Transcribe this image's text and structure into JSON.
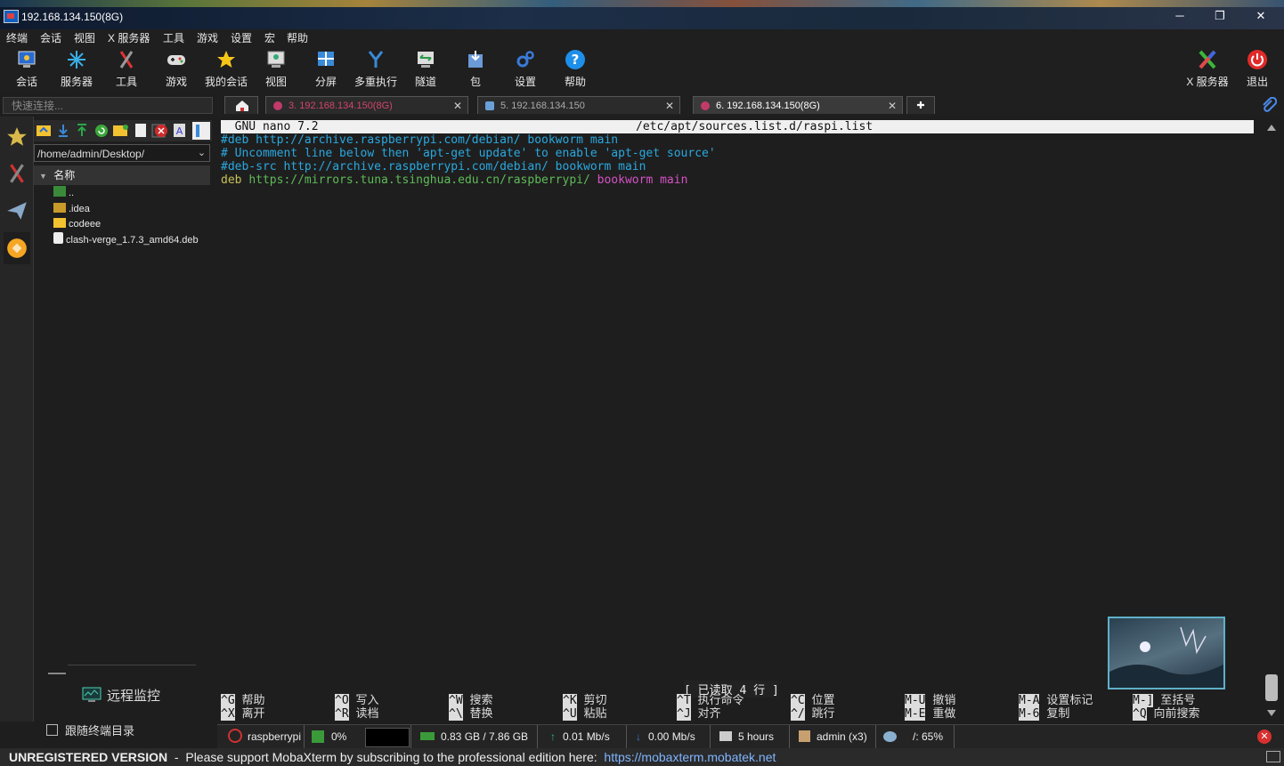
{
  "window": {
    "title": "192.168.134.150(8G)",
    "minimize": "─",
    "maximize": "❐",
    "close": "✕"
  },
  "menu": [
    "终端",
    "会话",
    "视图",
    "X 服务器",
    "工具",
    "游戏",
    "设置",
    "宏",
    "帮助"
  ],
  "toolbar": [
    {
      "label": "会话",
      "icon": "session-icon"
    },
    {
      "label": "服务器",
      "icon": "servers-icon"
    },
    {
      "label": "工具",
      "icon": "tools-icon"
    },
    {
      "label": "游戏",
      "icon": "games-icon"
    },
    {
      "label": "我的会话",
      "icon": "star-icon"
    },
    {
      "label": "视图",
      "icon": "view-icon"
    },
    {
      "label": "分屏",
      "icon": "split-icon"
    },
    {
      "label": "多重执行",
      "icon": "multiexec-icon"
    },
    {
      "label": "隧道",
      "icon": "tunnel-icon"
    },
    {
      "label": "包",
      "icon": "package-icon"
    },
    {
      "label": "设置",
      "icon": "settings-icon"
    },
    {
      "label": "帮助",
      "icon": "help-icon"
    }
  ],
  "toolbar_right": [
    {
      "label": "X 服务器",
      "icon": "xserver-icon"
    },
    {
      "label": "退出",
      "icon": "power-icon"
    }
  ],
  "quick_connect": {
    "placeholder": "快速连接..."
  },
  "tabs": [
    {
      "label": "3. 192.168.134.150(8G)",
      "close": "✕"
    },
    {
      "label": "5. 192.168.134.150",
      "close": "✕"
    },
    {
      "label": "6. 192.168.134.150(8G)",
      "close": "✕",
      "active": true
    }
  ],
  "sftp": {
    "path": "/home/admin/Desktop/",
    "column": "名称",
    "files": [
      {
        "name": "..",
        "type": "parent"
      },
      {
        "name": ".idea",
        "type": "folder"
      },
      {
        "name": "codeee",
        "type": "folder"
      },
      {
        "name": "clash-verge_1.7.3_amd64.deb",
        "type": "file"
      }
    ],
    "remote_monitor": "远程监控",
    "follow_terminal": "跟随终端目录"
  },
  "terminal": {
    "header_left": "  GNU nano 7.2",
    "header_right": "/etc/apt/sources.list.d/raspi.list",
    "lines": [
      {
        "text": "#deb http://archive.raspberrypi.com/debian/ bookworm main"
      },
      {
        "text": "# Uncomment line below then 'apt-get update' to enable 'apt-get source'"
      },
      {
        "text": "#deb-src http://archive.raspberrypi.com/debian/ bookworm main"
      },
      {
        "a": "deb ",
        "b": "https://mirrors.tuna.tsinghua.edu.cn/raspberrypi/ ",
        "c": "bookworm main"
      }
    ],
    "status": "[ 已读取 4 行 ]",
    "shortcuts": [
      {
        "k1": "^G",
        "l1": "帮助",
        "k2": "^X",
        "l2": "离开"
      },
      {
        "k1": "^O",
        "l1": "写入",
        "k2": "^R",
        "l2": "读档"
      },
      {
        "k1": "^W",
        "l1": "搜索",
        "k2": "^\\",
        "l2": "替换"
      },
      {
        "k1": "^K",
        "l1": "剪切",
        "k2": "^U",
        "l2": "粘贴"
      },
      {
        "k1": "^T",
        "l1": "执行命令",
        "k2": "^J",
        "l2": "对齐"
      },
      {
        "k1": "^C",
        "l1": "位置",
        "k2": "^/",
        "l2": "跳行"
      },
      {
        "k1": "M-U",
        "l1": "撤销",
        "k2": "M-E",
        "l2": "重做"
      },
      {
        "k1": "M-A",
        "l1": "设置标记",
        "k2": "M-6",
        "l2": "复制"
      },
      {
        "k1": "M-]",
        "l1": "至括号",
        "k2": "^Q",
        "l2": "向前搜索"
      }
    ]
  },
  "infobar": {
    "host": "raspberrypi",
    "cpu": "0%",
    "mem": "0.83 GB / 7.86 GB",
    "up": "0.01 Mb/s",
    "down": "0.00 Mb/s",
    "uptime": "5 hours",
    "users": "admin (x3)",
    "disk": "/: 65%"
  },
  "footer": {
    "version": "UNREGISTERED VERSION",
    "message": "  -  Please support MobaXterm by subscribing to the professional edition here:  ",
    "link": "https://mobaxterm.mobatek.net"
  }
}
